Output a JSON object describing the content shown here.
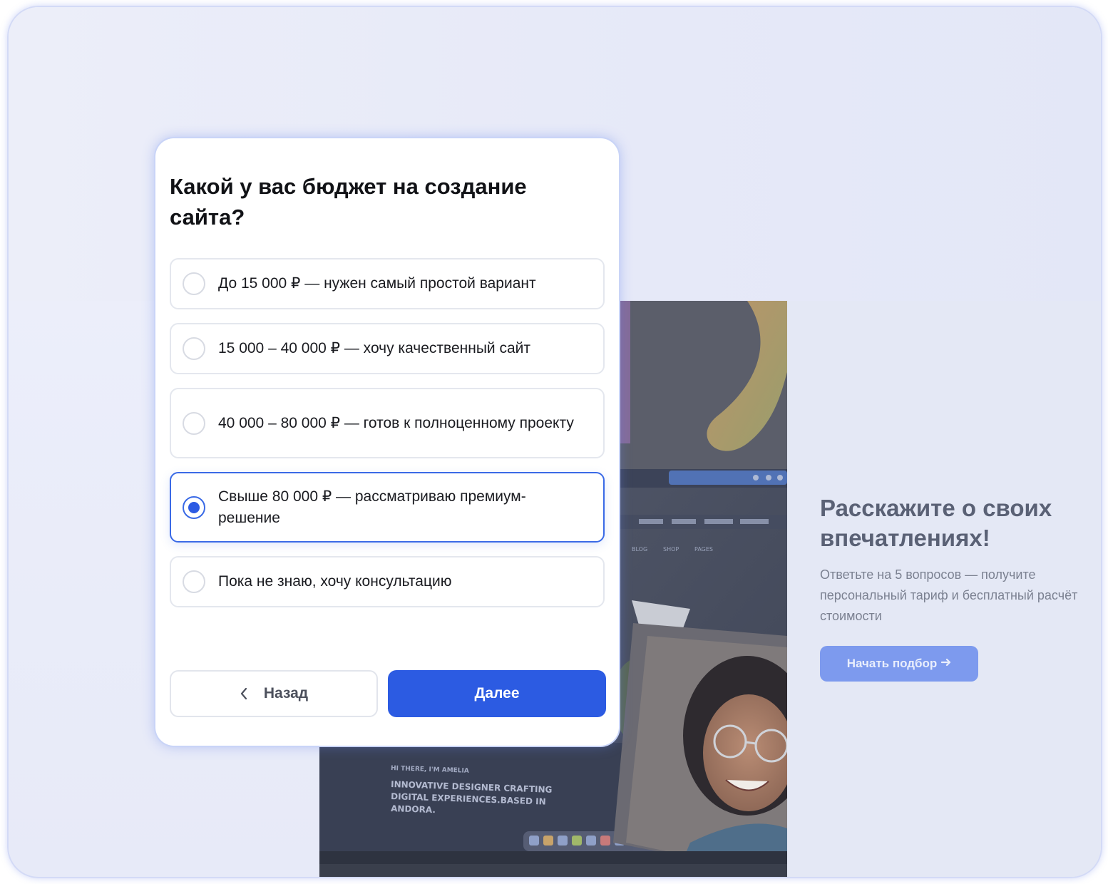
{
  "quiz": {
    "question": "Какой у вас бюджет на создание сайта?",
    "options": [
      {
        "label": "До 15 000 ₽ — нужен самый простой вариант",
        "selected": false
      },
      {
        "label": "15 000 – 40 000 ₽ — хочу качественный сайт",
        "selected": false
      },
      {
        "label": "40 000 – 80 000 ₽ — готов к полноценному проекту",
        "selected": false
      },
      {
        "label": "Свыше 80 000 ₽ — рассматриваю премиум-решение",
        "selected": true
      },
      {
        "label": "Пока не знаю, хочу консультацию",
        "selected": false
      }
    ],
    "back_label": "Назад",
    "next_label": "Далее",
    "accent_color": "#2c5be2"
  },
  "hero": {
    "title": "Расскажите о своих впечатлениях!",
    "subtitle_lines": [
      "Ответьте на 5 вопросов — получите",
      "персональный тариф и бесплатный расчёт",
      "стоимости"
    ],
    "cta_label": "Начать подбор",
    "cta_icon": "arrow-right-icon",
    "photo_texts": {
      "tabs": [
        "BLOG",
        "SHOP",
        "PAGES"
      ],
      "greeting": "HI THERE, I'M AMELIA",
      "headline_lines": [
        "INNOVATIVE DESIGNER CRAFTING",
        "DIGITAL EXPERIENCES.BASED IN",
        "ANDORA."
      ]
    }
  }
}
